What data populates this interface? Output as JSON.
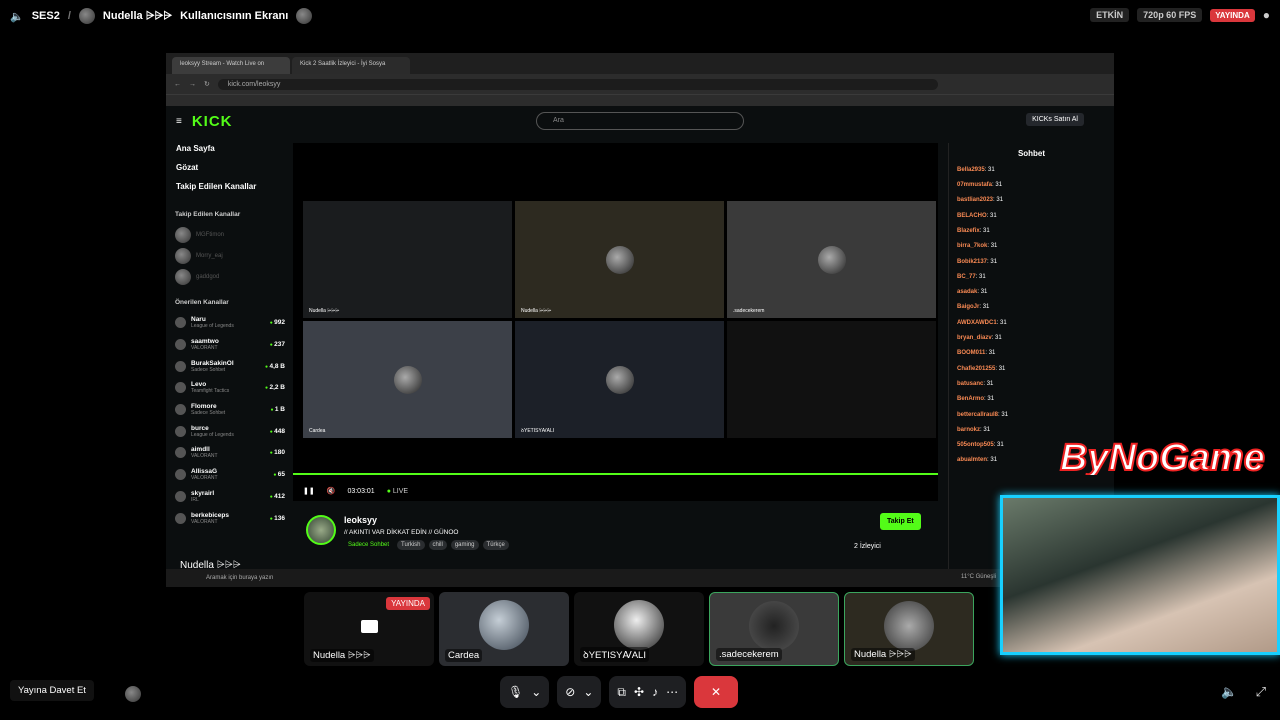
{
  "topbar": {
    "channel": "SES2",
    "screen_title_user": "Nudella ⩥⩥⩥",
    "screen_title_suffix": "Kullanıcısının Ekranı",
    "status": "ETKİN",
    "quality": "720p 60 FPS",
    "live": "YAYINDA"
  },
  "browser": {
    "tab1": "leoksyy Stream - Watch Live on",
    "tab2": "Kick 2 Saatlik İzleyici - İyi Sosya",
    "url": "kick.com/leoksyy"
  },
  "kick": {
    "logo": "KICK",
    "search_placeholder": "Ara",
    "buy": "KICKs Satın Al",
    "nav": [
      "Ana Sayfa",
      "Gözat",
      "Takip Edilen Kanallar"
    ],
    "followed_heading": "Takip Edilen Kanallar",
    "followed": [
      "MGFtimon",
      "Morry_eaj",
      "gaddgod"
    ],
    "recommended_heading": "Önerilen Kanallar",
    "recommended": [
      {
        "name": "Naru",
        "game": "League of Legends",
        "viewers": "992"
      },
      {
        "name": "saamtwo",
        "game": "VALORANT",
        "viewers": "237"
      },
      {
        "name": "BurakSakinOl",
        "game": "Sadece Sohbet",
        "viewers": "4,8 B"
      },
      {
        "name": "Levo",
        "game": "Teamfight Tactics",
        "viewers": "2,2 B"
      },
      {
        "name": "Flomore",
        "game": "Sadece Sohbet",
        "viewers": "1 B"
      },
      {
        "name": "burce",
        "game": "League of Legends",
        "viewers": "448"
      },
      {
        "name": "aimdll",
        "game": "VALORANT",
        "viewers": "180"
      },
      {
        "name": "AllissaG",
        "game": "VALORANT",
        "viewers": "65"
      },
      {
        "name": "skyrairl",
        "game": "IRL",
        "viewers": "412"
      },
      {
        "name": "berkebiceps",
        "game": "VALORANT",
        "viewers": "136"
      }
    ],
    "tiles": [
      "Nudella ⩥⩥⩥",
      "Nudella ⩥⩥⩥",
      ".sadecekerem",
      "Cardea",
      "ꝺYETISYꜸALI",
      ""
    ],
    "timer": "03:03:01",
    "live": "LIVE",
    "streamer": "leoksyy",
    "stream_title": "// AKINTI VAR DİKKAT EDİN // GÜNOO",
    "category": "Sadece Sohbet",
    "tags": [
      "Turkish",
      "chill",
      "gaming",
      "Türkçe"
    ],
    "viewers": "2 İzleyici",
    "follow": "Takip Et",
    "chat_title": "Sohbet",
    "chat": [
      {
        "user": "Bella2935",
        "msg": "31"
      },
      {
        "user": "07mmustafa",
        "msg": "31"
      },
      {
        "user": "bastlian2023",
        "msg": "31"
      },
      {
        "user": "BELACHO",
        "msg": "31"
      },
      {
        "user": "Blazefix",
        "msg": "31"
      },
      {
        "user": "birra_7kok",
        "msg": "31"
      },
      {
        "user": "Bobik2137",
        "msg": "31"
      },
      {
        "user": "BC_77",
        "msg": "31"
      },
      {
        "user": "asadak",
        "msg": "31"
      },
      {
        "user": "BaigoJr",
        "msg": "31"
      },
      {
        "user": "AWDXAWDC1",
        "msg": "31"
      },
      {
        "user": "bryan_diazv",
        "msg": "31"
      },
      {
        "user": "BOOM011",
        "msg": "31"
      },
      {
        "user": "Chafie201255",
        "msg": "31"
      },
      {
        "user": "batusanc",
        "msg": "31"
      },
      {
        "user": "BenArmo",
        "msg": "31"
      },
      {
        "user": "bettercallraul8",
        "msg": "31"
      },
      {
        "user": "barnokz",
        "msg": "31"
      },
      {
        "user": "505ontop505",
        "msg": "31"
      },
      {
        "user": "abualmten",
        "msg": "31"
      }
    ],
    "weather": "11°C Güneşli",
    "taskbar_search": "Aramak için buraya yazın"
  },
  "overlay": {
    "logo_text": "ByNoGame"
  },
  "participants": [
    {
      "name": "Nudella ⩥⩥⩥",
      "badge": "YAYINDA"
    },
    {
      "name": "Cardea"
    },
    {
      "name": "ꝺYETISYꜸALI"
    },
    {
      "name": ".sadecekerem"
    },
    {
      "name": "Nudella ⩥⩥⩥"
    }
  ],
  "bottom": {
    "invite": "Yayına Davet Et"
  },
  "colors": {
    "kick_green": "#53fc18",
    "discord_red": "#da373c",
    "cam_border": "#18d0ff"
  }
}
